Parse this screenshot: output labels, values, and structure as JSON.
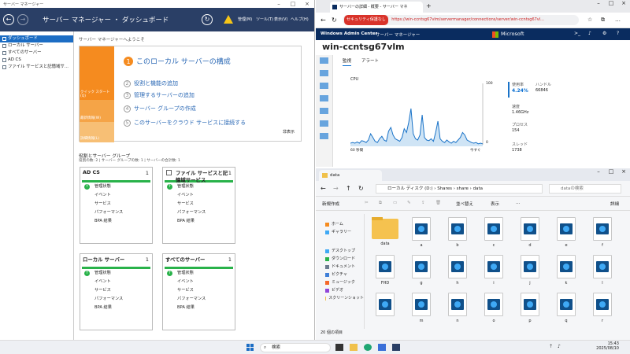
{
  "server_manager": {
    "window_title": "サーバー マネージャー",
    "breadcrumb": "サーバー マネージャー ・ ダッシュボード",
    "menu": [
      "管理(M)",
      "ツール(T)",
      "表示(V)",
      "ヘルプ(H)"
    ],
    "sidebar": [
      "ダッシュボード",
      "ローカル サーバー",
      "すべてのサーバー",
      "AD CS",
      "ファイル サービスと記憶域サ..."
    ],
    "welcome": "サーバー マネージャーへようこそ",
    "quick_tiles": [
      "クイック スタート(Q)",
      "最新情報(W)",
      "詳細情報(L)"
    ],
    "quick_items": [
      {
        "num": "1",
        "label": "このローカル サーバーの構成"
      },
      {
        "num": "2",
        "label": "役割と機能の追加"
      },
      {
        "num": "3",
        "label": "管理するサーバーの追加"
      },
      {
        "num": "4",
        "label": "サーバー グループの作成"
      },
      {
        "num": "5",
        "label": "このサーバーをクラウド サービスに接続する"
      }
    ],
    "hide_label": "非表示",
    "group_heading": "役割とサーバー グループ",
    "group_sub": "役割の数: 2 | サーバー グループの数: 1 | サーバーの合計数: 1",
    "cards": [
      {
        "title": "AD CS",
        "count": "1",
        "items": [
          "管理状態",
          "イベント",
          "サービス",
          "パフォーマンス",
          "BPA 結果"
        ]
      },
      {
        "title": "ファイル サービスと記憶域サービス",
        "count": "1",
        "items": [
          "管理状態",
          "イベント",
          "サービス",
          "パフォーマンス",
          "BPA 結果"
        ]
      },
      {
        "title": "ローカル サーバー",
        "count": "1",
        "items": [
          "管理状態",
          "イベント",
          "サービス",
          "パフォーマンス",
          "BPA 結果"
        ]
      },
      {
        "title": "すべてのサーバー",
        "count": "1",
        "items": [
          "管理状態",
          "イベント",
          "サービス",
          "パフォーマンス",
          "BPA 結果"
        ]
      }
    ]
  },
  "browser": {
    "tab_title": "サーバーの詳細 - 概要 - サーバー マネ",
    "security_badge": "セキュリティ保護なし",
    "url": "https://win-ccntsg67vlm/servermanager/connections/server/win-ccntsg67vl...",
    "wac_title": "Windows Admin Center",
    "wac_section": "サーバー マネージャー",
    "brand": "Microsoft",
    "server_name": "win-ccntsg67vlm",
    "tabs": [
      "監視",
      "アラート"
    ],
    "cpu_label": "CPU",
    "axis": {
      "ymax": "100",
      "ymin": "0",
      "xleft": "60 秒間",
      "xright": "今すぐ"
    },
    "stats": [
      {
        "label": "使用率",
        "value": "4.24%"
      },
      {
        "label": "ハンドル",
        "value": "66846"
      },
      {
        "label": "速度",
        "value": "1.46GHz"
      },
      {
        "label": "プロセス",
        "value": "154"
      },
      {
        "label": "スレッド",
        "value": "1738"
      }
    ],
    "cpu_series": [
      5,
      6,
      5,
      7,
      5,
      9,
      8,
      6,
      10,
      20,
      14,
      8,
      6,
      12,
      16,
      10,
      8,
      24,
      30,
      18,
      12,
      10,
      8,
      14,
      28,
      22,
      38,
      60,
      20,
      12,
      10,
      18,
      50,
      14,
      10,
      9,
      12,
      8,
      22,
      40,
      12,
      8,
      6,
      10,
      7,
      5,
      8,
      6,
      10,
      14,
      22,
      18,
      10,
      8,
      6,
      5,
      6,
      4,
      5,
      4
    ]
  },
  "explorer": {
    "tab_title": "data",
    "path": [
      "ローカル ディスク (D:)",
      "Shares",
      "share",
      "data"
    ],
    "search_placeholder": "dataの検索",
    "toolbar": {
      "new": "新規作成",
      "sort": "並べ替え",
      "view": "表示",
      "details": "詳細"
    },
    "nav": [
      "ホーム",
      "ギャラリー",
      "デスクトップ",
      "ダウンロード",
      "ドキュメント",
      "ピクチャ",
      "ミュージック",
      "ビデオ",
      "スクリーンショット"
    ],
    "files": [
      "data",
      "a",
      "b",
      "c",
      "d",
      "e",
      "f",
      "FHD",
      "g",
      "h",
      "i",
      "j",
      "k",
      "l",
      "",
      "m",
      "n",
      "o",
      "p",
      "q",
      "r"
    ],
    "status": "20 個の項目"
  },
  "taskbar": {
    "search": "検索",
    "time": "15:43",
    "date": "2025/08/10"
  },
  "colors": {
    "accent": "#1c6dc4",
    "orange": "#f58b1f",
    "green": "#29b24a",
    "navy": "#2a3f66",
    "wac": "#0a2c5f"
  }
}
